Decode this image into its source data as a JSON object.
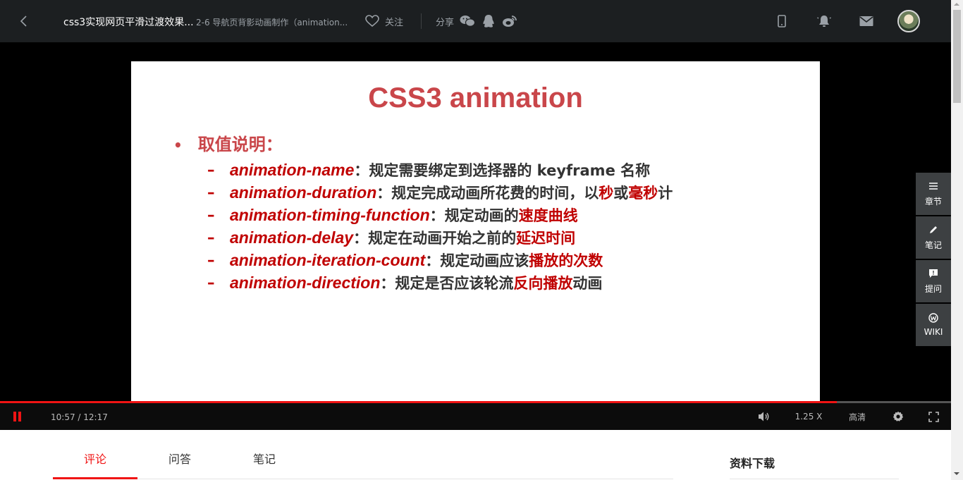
{
  "header": {
    "course_title": "css3实现网页平滑过渡效果...",
    "lesson_title": "2-6 导航页背影动画制作（animation...",
    "follow_label": "关注",
    "share_label": "分享"
  },
  "slide": {
    "title": "CSS3 animation",
    "bullet": "取值说明：",
    "items": [
      {
        "dash": "–",
        "prop": "animation-name",
        "sep": "：",
        "desc": "规定需要绑定到选择器的 keyframe 名称",
        "hl1": "",
        "mid": "",
        "hl2": "",
        "tail": ""
      },
      {
        "dash": "–",
        "prop": "animation-duration",
        "sep": "：",
        "desc": "规定完成动画所花费的时间，以",
        "hl1": "秒",
        "mid": "或",
        "hl2": "毫秒",
        "tail": "计"
      },
      {
        "dash": "–",
        "prop": "animation-timing-function",
        "sep": "：",
        "desc": "规定动画的",
        "hl1": "速度曲线",
        "mid": "",
        "hl2": "",
        "tail": ""
      },
      {
        "dash": "–",
        "prop": "animation-delay",
        "sep": "：",
        "desc": "规定在动画开始之前的",
        "hl1": "延迟时间",
        "mid": "",
        "hl2": "",
        "tail": ""
      },
      {
        "dash": "–",
        "prop": "animation-iteration-count",
        "sep": "：",
        "desc": "规定动画应该",
        "hl1": "播放的次数",
        "mid": "",
        "hl2": "",
        "tail": ""
      },
      {
        "dash": "–",
        "prop": "animation-direction",
        "sep": "：",
        "desc": "规定是否应该轮流",
        "hl1": "反向播放",
        "mid": "",
        "hl2": "",
        "tail": "动画"
      }
    ]
  },
  "side_panel": {
    "chapters": "章节",
    "notes": "笔记",
    "ask": "提问",
    "wiki": "WIKI"
  },
  "player": {
    "time": "10:57 / 12:17",
    "progress": 0.88,
    "speed": "1.25 X",
    "quality": "高清"
  },
  "tabs": {
    "comments": "评论",
    "qa": "问答",
    "notes": "笔记"
  },
  "download": {
    "title": "资料下载"
  },
  "colors": {
    "accent": "#f01414",
    "slide_red": "#c9464a",
    "topbar": "#1c1f21",
    "side": "#3d4042"
  }
}
